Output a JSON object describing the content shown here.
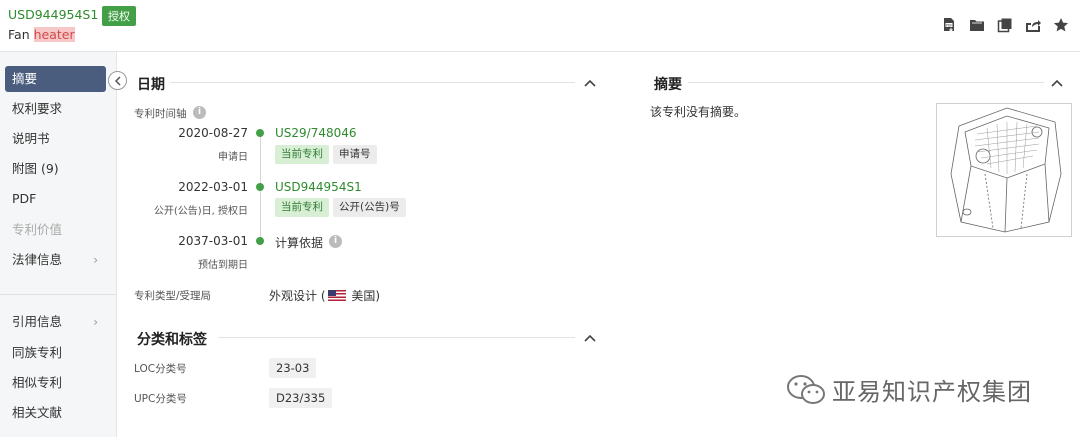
{
  "header": {
    "patent_id": "USD944954S1",
    "status_badge": "授权",
    "subtitle_prefix": "Fan ",
    "subtitle_highlight": "heater"
  },
  "toolbar": {
    "icons": [
      "pdf-download-icon",
      "folder-icon",
      "copy-icon",
      "export-icon",
      "star-icon"
    ]
  },
  "sidebar": {
    "items": [
      {
        "label": "摘要",
        "active": true
      },
      {
        "label": "权利要求"
      },
      {
        "label": "说明书"
      },
      {
        "label": "附图 (9)"
      },
      {
        "label": "PDF"
      },
      {
        "label": "专利价值",
        "disabled": true
      },
      {
        "label": "法律信息",
        "chevron": "›"
      },
      {
        "label": "引用信息",
        "chevron": "›"
      },
      {
        "label": "同族专利"
      },
      {
        "label": "相似专利"
      },
      {
        "label": "相关文献"
      }
    ]
  },
  "dates": {
    "title": "日期",
    "timeline_label": "专利时间轴",
    "events": [
      {
        "date": "2020-08-27",
        "sub": "申请日",
        "link": "US29/748046",
        "tags": [
          "当前专利",
          "申请号"
        ]
      },
      {
        "date": "2022-03-01",
        "sub": "公开(公告)日, 授权日",
        "link": "USD944954S1",
        "tags": [
          "当前专利",
          "公开(公告)号"
        ]
      },
      {
        "date": "2037-03-01",
        "sub": "预估到期日",
        "text": "计算依据"
      }
    ],
    "type_label": "专利类型/受理局",
    "type_value_prefix": "外观设计 (",
    "type_value_country": "美国)"
  },
  "classification": {
    "title": "分类和标签",
    "loc_label": "LOC分类号",
    "loc_value": "23-03",
    "upc_label": "UPC分类号",
    "upc_value": "D23/335"
  },
  "abstract": {
    "title": "摘要",
    "text": "该专利没有摘要。"
  },
  "watermark": {
    "text": "亚易知识产权集团"
  },
  "colors": {
    "accent_green": "#43a047",
    "link_green": "#2e8b2e",
    "sidebar_active": "#4a5d7e",
    "highlight_bg": "#f6c7c7"
  }
}
